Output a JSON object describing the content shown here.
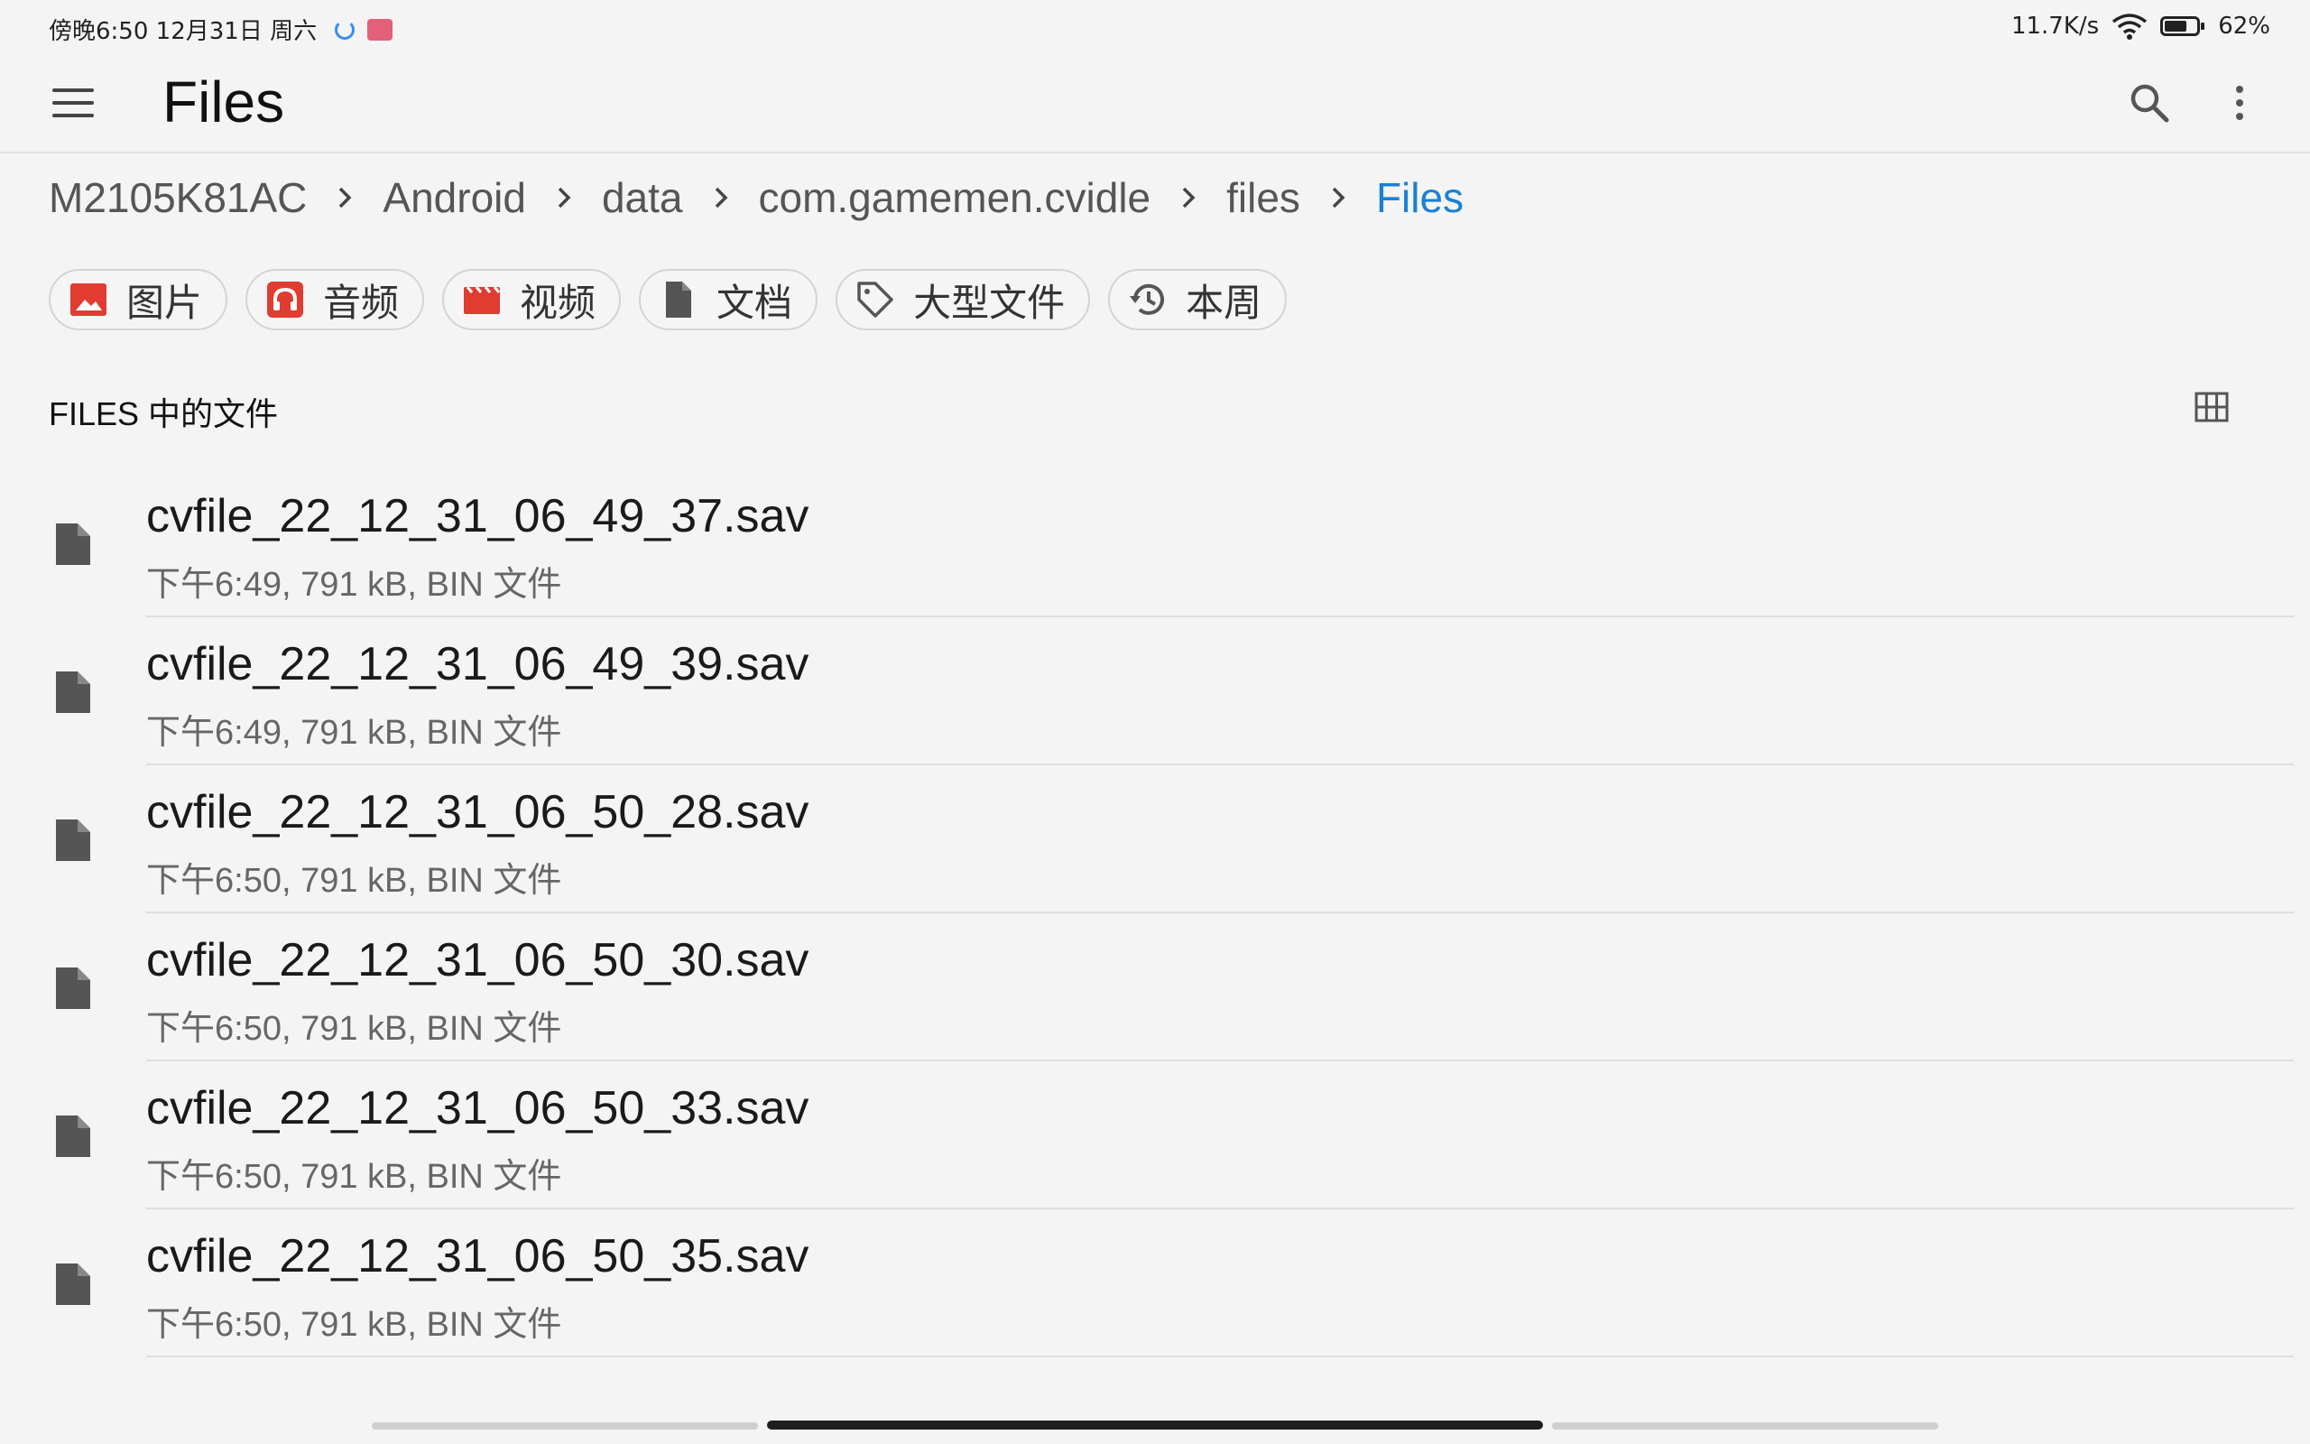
{
  "status_bar": {
    "time_date": "傍晚6:50  12月31日 周六",
    "net_speed": "11.7K/s",
    "battery_percent": "62%",
    "battery_level": 0.62
  },
  "app_bar": {
    "title": "Files",
    "menu_icon": "menu-icon",
    "search_icon": "search-icon",
    "more_icon": "more-vert-icon"
  },
  "breadcrumb": [
    "M2105K81AC",
    "Android",
    "data",
    "com.gamemen.cvidle",
    "files",
    "Files"
  ],
  "chips": [
    {
      "label": "图片",
      "icon": "image-icon",
      "color": "#e03c31"
    },
    {
      "label": "音频",
      "icon": "headphones-icon",
      "color": "#e03c31"
    },
    {
      "label": "视频",
      "icon": "video-icon",
      "color": "#e03c31"
    },
    {
      "label": "文档",
      "icon": "document-icon",
      "color": "#555555"
    },
    {
      "label": "大型文件",
      "icon": "tag-icon",
      "color": "#555555"
    },
    {
      "label": "本周",
      "icon": "history-icon",
      "color": "#555555"
    }
  ],
  "section": {
    "title": "FILES 中的文件",
    "view_toggle_icon": "grid-view-icon"
  },
  "files": [
    {
      "name": "cvfile_22_12_31_06_49_37.sav",
      "meta": "下午6:49, 791 kB, BIN 文件"
    },
    {
      "name": "cvfile_22_12_31_06_49_39.sav",
      "meta": "下午6:49, 791 kB, BIN 文件"
    },
    {
      "name": "cvfile_22_12_31_06_50_28.sav",
      "meta": "下午6:50, 791 kB, BIN 文件"
    },
    {
      "name": "cvfile_22_12_31_06_50_30.sav",
      "meta": "下午6:50, 791 kB, BIN 文件"
    },
    {
      "name": "cvfile_22_12_31_06_50_33.sav",
      "meta": "下午6:50, 791 kB, BIN 文件"
    },
    {
      "name": "cvfile_22_12_31_06_50_35.sav",
      "meta": "下午6:50, 791 kB, BIN 文件"
    }
  ],
  "colors": {
    "accent": "#1a80d6",
    "background": "#f4f4f4",
    "icon_red": "#e03c31"
  }
}
